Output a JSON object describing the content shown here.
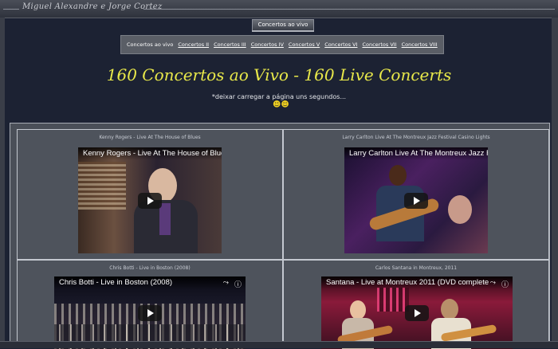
{
  "header": {
    "site_name": "Miguel Alexandre e Jorge Cortez",
    "active_tab": "Concertos ao vivo"
  },
  "subnav": {
    "items": [
      {
        "label": "Concertos ao vivo",
        "current": true
      },
      {
        "label": "Concertos  II"
      },
      {
        "label": "Concertos III"
      },
      {
        "label": "Concertos IV"
      },
      {
        "label": "Concertos V"
      },
      {
        "label": "Concertos VI"
      },
      {
        "label": "Concertos VII"
      },
      {
        "label": "Concertos VIII"
      }
    ]
  },
  "main": {
    "headline": "160 Concertos ao Vivo - 160 Live Concerts",
    "note": "*deixar carregar a página uns segundos...",
    "smileys": "☻☻"
  },
  "videos": [
    {
      "caption": "Kenny Rogers - Live At The House of Blues",
      "player_title": "Kenny Rogers - Live At The House of Blues"
    },
    {
      "caption": "Larry Carlton Live At The Montreux Jazz Festival Casino Lights",
      "player_title": "Larry Carlton  Live At The Montreux Jazz F"
    },
    {
      "caption": "Chris Botti - Live in Boston (2008)",
      "player_title": "Chris Botti - Live in Boston (2008)"
    },
    {
      "caption": "Carlos Santana in Montreux, 2011",
      "player_title": "Santana - Live at Montreux 2011 (DVD complete"
    }
  ],
  "icons": {
    "share": "share-icon",
    "info": "info-icon",
    "play": "play-icon"
  },
  "colors": {
    "background": "#1c2233",
    "headline": "#e8e84a",
    "panel": "#4e535c"
  }
}
